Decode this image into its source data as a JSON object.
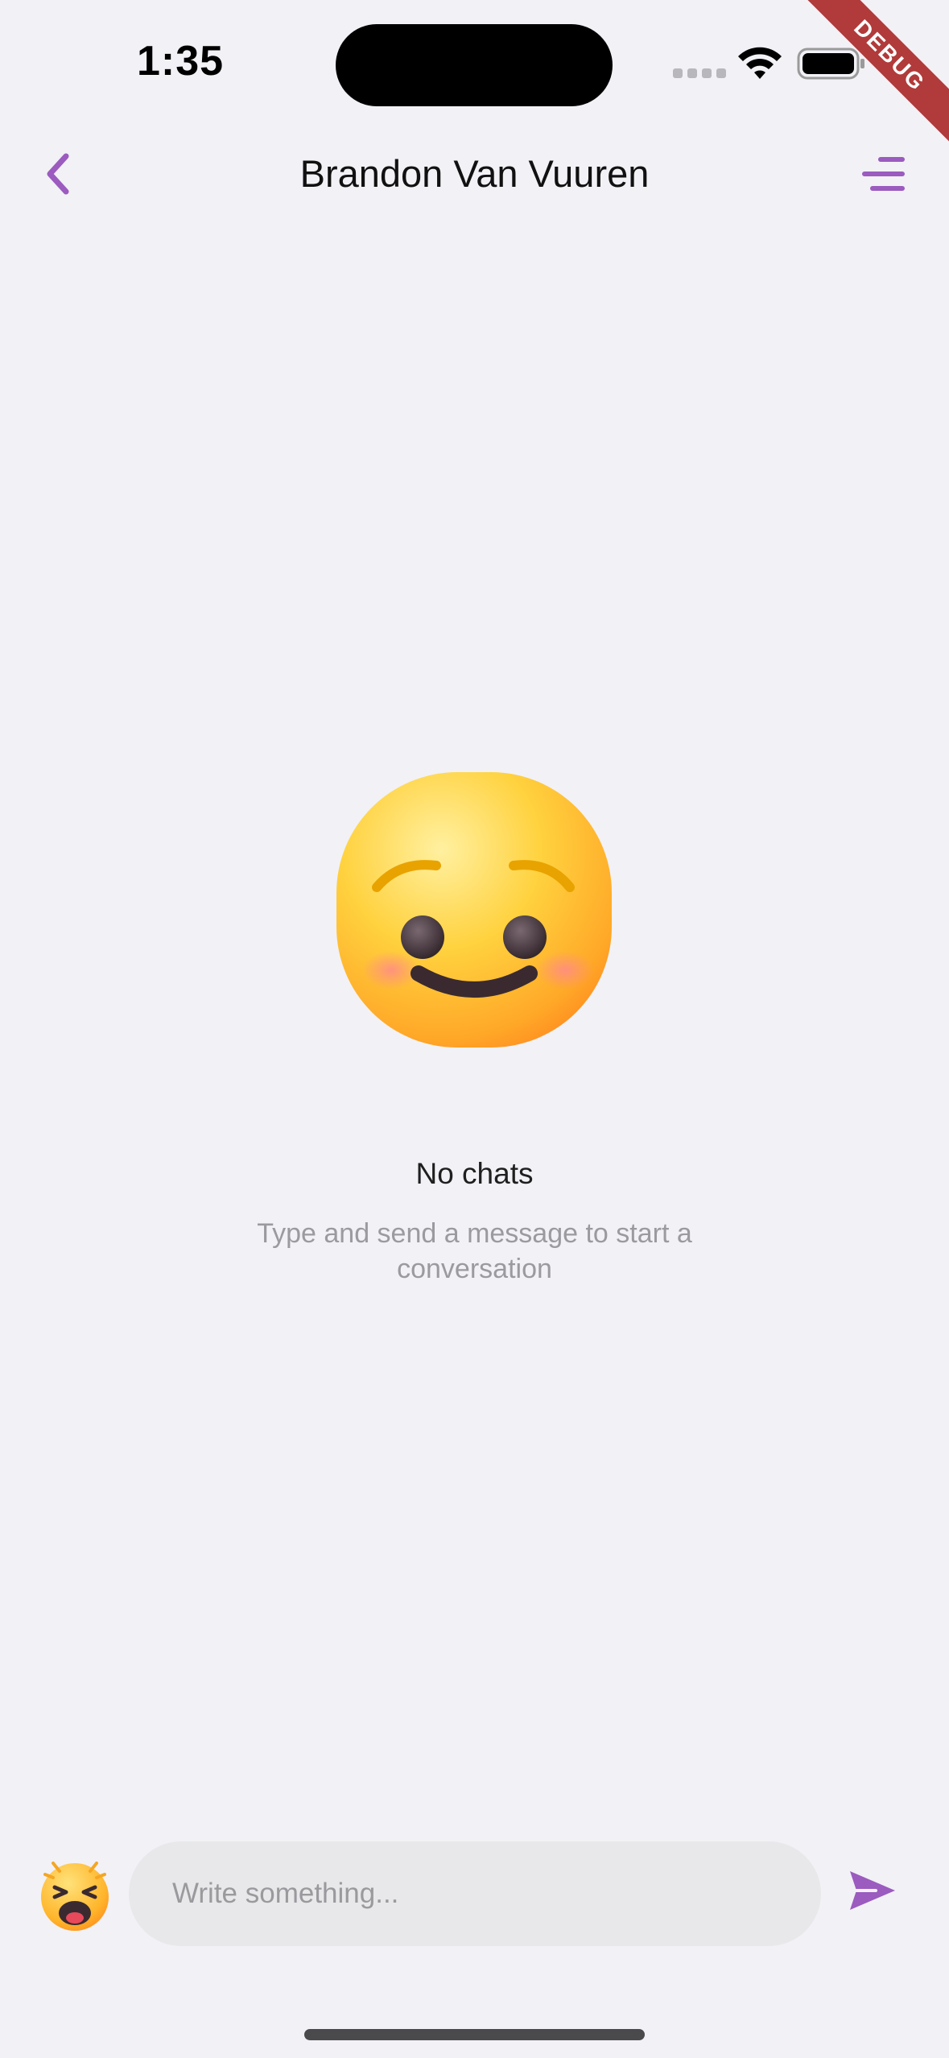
{
  "status_bar": {
    "time": "1:35"
  },
  "debug_banner": {
    "label": "DEBUG"
  },
  "header": {
    "title": "Brandon Van Vuuren",
    "back_icon": "chevron-left-icon",
    "menu_icon": "menu-lines-icon"
  },
  "empty_state": {
    "emoji": "smiling-face-icon",
    "title": "No chats",
    "subtitle": "Type and send a message to start a conversation"
  },
  "composer": {
    "emoji_icon": "tired-face-icon",
    "input_value": "",
    "placeholder": "Write something...",
    "send_icon": "send-icon"
  },
  "colors": {
    "accent": "#9b5bbf",
    "background": "#f2f1f6",
    "input_background": "#e8e8ea",
    "debug_banner": "#b13a3a"
  }
}
